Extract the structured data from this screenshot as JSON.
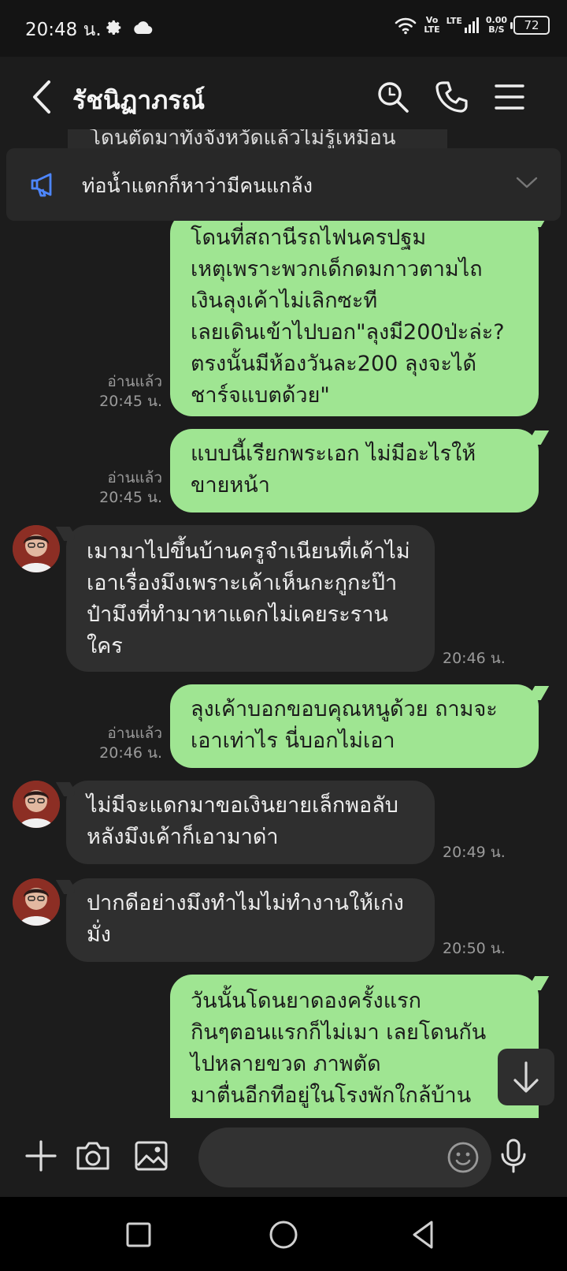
{
  "status_bar": {
    "time": "20:48 น.",
    "volte_top": "Vo",
    "volte_bottom": "LTE",
    "lte": "LTE",
    "speed_value": "0.00",
    "speed_unit": "B/S",
    "battery": "72",
    "icons": [
      "gear-icon",
      "cloud-icon",
      "wifi-icon",
      "signal-icon"
    ]
  },
  "header": {
    "title": "รัชนิฏาภรณ์",
    "icons": [
      "back-icon",
      "search-icon",
      "phone-icon",
      "menu-icon"
    ]
  },
  "announcement": {
    "peek_text": "โดนตัดมาทั้งจังหวัดแล้วไม่รู้เหมือน",
    "text": "ท่อน้ำแตกก็หาว่ามีคนแกล้ง"
  },
  "messages": [
    {
      "side": "out",
      "text": "โดนที่สถานีรถไฟนครปฐม\nเหตุเพราะพวกเด็กดมกาวตามไถ\nเงินลุงเค้าไม่เลิกซะที\nเลยเดินเข้าไปบอก\"ลุงมี200ป่ะล่ะ?\nตรงนั้นมีห้องวันละ200 ลุงจะได้\nชาร์จแบตด้วย\"",
      "read": "อ่านแล้ว",
      "time": "20:45 น."
    },
    {
      "side": "out",
      "text": "แบบนี้เรียกพระเอก ไม่มีอะไรให้\nขายหน้า",
      "read": "อ่านแล้ว",
      "time": "20:45 น."
    },
    {
      "side": "in",
      "text": "เมามาไปขึ้นบ้านครูจำเนียนที่เค้าไม่\nเอาเรื่องมึงเพราะเค้าเห็นกะกูกะป๊า\nป๋ามึงที่ทำมาหาแดกไม่เคยระราน\nใคร",
      "time": "20:46 น."
    },
    {
      "side": "out",
      "text": "ลุงเค้าบอกขอบคุณหนูด้วย ถามจะ\nเอาเท่าไร นี่บอกไม่เอา",
      "read": "อ่านแล้ว",
      "time": "20:46 น."
    },
    {
      "side": "in",
      "text": "ไม่มีจะแดกมาขอเงินยายเล็กพอลับ\nหลังมึงเค้าก็เอามาด่า",
      "time": "20:49 น."
    },
    {
      "side": "in",
      "text": "ปากดีอย่างมึงทำไมไม่ทำงานให้เก่ง\nมั่ง",
      "time": "20:50 น."
    },
    {
      "side": "out",
      "text": "วันนั้นโดนยาดองครั้งแรก\nกินๆตอนแรกก็ไม่เมา เลยโดนกัน\nไปหลายขวด ภาพตัด\nมาตื่นอีกทีอยู่ในโรงพักใกล้บ้าน"
    }
  ],
  "input_bar": {
    "placeholder": "",
    "icons": [
      "plus-icon",
      "camera-icon",
      "image-icon",
      "emoji-icon",
      "microphone-icon"
    ]
  },
  "nav_bar": {
    "icons": [
      "recent-apps-icon",
      "home-icon",
      "back-nav-icon"
    ]
  }
}
